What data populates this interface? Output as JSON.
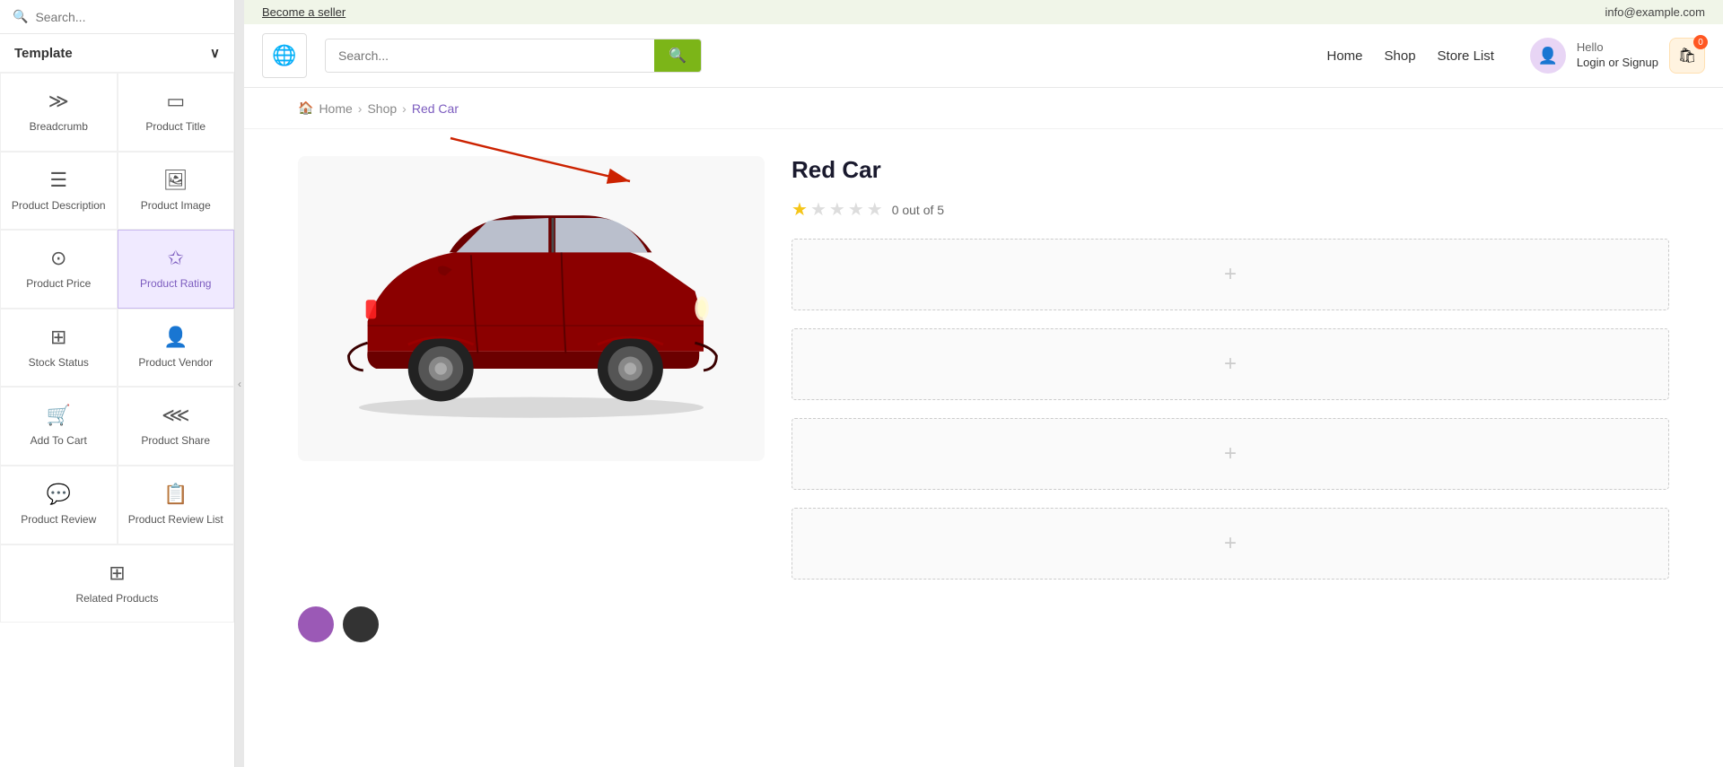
{
  "sidebar": {
    "search_placeholder": "Search...",
    "section_label": "Template",
    "items": [
      {
        "id": "breadcrumb",
        "label": "Breadcrumb",
        "icon": "≫",
        "active": false
      },
      {
        "id": "product-title",
        "label": "Product Title",
        "icon": "▭",
        "active": false
      },
      {
        "id": "product-description",
        "label": "Product Description",
        "icon": "☰",
        "active": false
      },
      {
        "id": "product-image",
        "label": "Product Image",
        "icon": "🖼",
        "active": false
      },
      {
        "id": "product-price",
        "label": "Product Price",
        "icon": "⊙",
        "active": false
      },
      {
        "id": "product-rating",
        "label": "Product Rating",
        "icon": "✩",
        "active": true
      },
      {
        "id": "stock-status",
        "label": "Stock Status",
        "icon": "⊞",
        "active": false
      },
      {
        "id": "product-vendor",
        "label": "Product Vendor",
        "icon": "👤",
        "active": false
      },
      {
        "id": "add-to-cart",
        "label": "Add To Cart",
        "icon": "🛒",
        "active": false
      },
      {
        "id": "product-share",
        "label": "Product Share",
        "icon": "⋘",
        "active": false
      },
      {
        "id": "product-review",
        "label": "Product Review",
        "icon": "💬",
        "active": false
      },
      {
        "id": "product-review-list",
        "label": "Product Review List",
        "icon": "📋",
        "active": false
      },
      {
        "id": "related-products",
        "label": "Related Products",
        "icon": "⊞",
        "active": false
      }
    ]
  },
  "topbar": {
    "become_seller": "Become a seller",
    "email": "info@example.com"
  },
  "header": {
    "logo_icon": "🌐",
    "search_placeholder": "Search...",
    "nav_items": [
      "Home",
      "Shop",
      "Store List"
    ],
    "user_hello": "Hello",
    "user_action": "Login or Signup",
    "cart_badge": "0"
  },
  "breadcrumb": {
    "home": "Home",
    "shop": "Shop",
    "current": "Red Car"
  },
  "product": {
    "title": "Red Car",
    "rating_text": "0 out of 5",
    "stars_filled": 1,
    "stars_total": 5
  },
  "placeholders": {
    "plus_icon": "+"
  }
}
